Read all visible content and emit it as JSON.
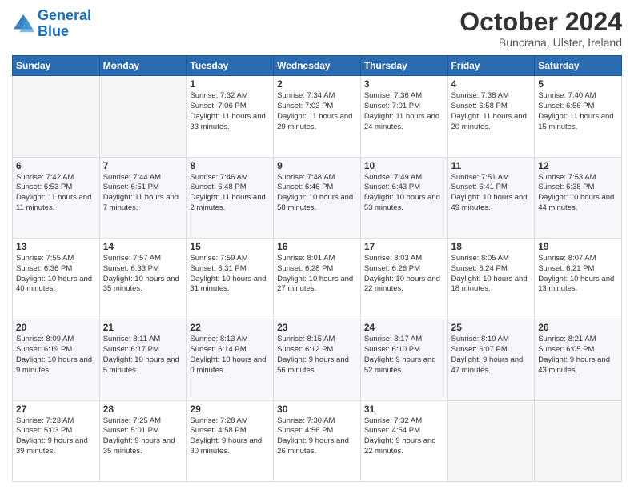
{
  "logo": {
    "text1": "General",
    "text2": "Blue"
  },
  "header": {
    "month": "October 2024",
    "location": "Buncrana, Ulster, Ireland"
  },
  "weekdays": [
    "Sunday",
    "Monday",
    "Tuesday",
    "Wednesday",
    "Thursday",
    "Friday",
    "Saturday"
  ],
  "weeks": [
    [
      {
        "day": "",
        "sunrise": "",
        "sunset": "",
        "daylight": ""
      },
      {
        "day": "",
        "sunrise": "",
        "sunset": "",
        "daylight": ""
      },
      {
        "day": "1",
        "sunrise": "Sunrise: 7:32 AM",
        "sunset": "Sunset: 7:06 PM",
        "daylight": "Daylight: 11 hours and 33 minutes."
      },
      {
        "day": "2",
        "sunrise": "Sunrise: 7:34 AM",
        "sunset": "Sunset: 7:03 PM",
        "daylight": "Daylight: 11 hours and 29 minutes."
      },
      {
        "day": "3",
        "sunrise": "Sunrise: 7:36 AM",
        "sunset": "Sunset: 7:01 PM",
        "daylight": "Daylight: 11 hours and 24 minutes."
      },
      {
        "day": "4",
        "sunrise": "Sunrise: 7:38 AM",
        "sunset": "Sunset: 6:58 PM",
        "daylight": "Daylight: 11 hours and 20 minutes."
      },
      {
        "day": "5",
        "sunrise": "Sunrise: 7:40 AM",
        "sunset": "Sunset: 6:56 PM",
        "daylight": "Daylight: 11 hours and 15 minutes."
      }
    ],
    [
      {
        "day": "6",
        "sunrise": "Sunrise: 7:42 AM",
        "sunset": "Sunset: 6:53 PM",
        "daylight": "Daylight: 11 hours and 11 minutes."
      },
      {
        "day": "7",
        "sunrise": "Sunrise: 7:44 AM",
        "sunset": "Sunset: 6:51 PM",
        "daylight": "Daylight: 11 hours and 7 minutes."
      },
      {
        "day": "8",
        "sunrise": "Sunrise: 7:46 AM",
        "sunset": "Sunset: 6:48 PM",
        "daylight": "Daylight: 11 hours and 2 minutes."
      },
      {
        "day": "9",
        "sunrise": "Sunrise: 7:48 AM",
        "sunset": "Sunset: 6:46 PM",
        "daylight": "Daylight: 10 hours and 58 minutes."
      },
      {
        "day": "10",
        "sunrise": "Sunrise: 7:49 AM",
        "sunset": "Sunset: 6:43 PM",
        "daylight": "Daylight: 10 hours and 53 minutes."
      },
      {
        "day": "11",
        "sunrise": "Sunrise: 7:51 AM",
        "sunset": "Sunset: 6:41 PM",
        "daylight": "Daylight: 10 hours and 49 minutes."
      },
      {
        "day": "12",
        "sunrise": "Sunrise: 7:53 AM",
        "sunset": "Sunset: 6:38 PM",
        "daylight": "Daylight: 10 hours and 44 minutes."
      }
    ],
    [
      {
        "day": "13",
        "sunrise": "Sunrise: 7:55 AM",
        "sunset": "Sunset: 6:36 PM",
        "daylight": "Daylight: 10 hours and 40 minutes."
      },
      {
        "day": "14",
        "sunrise": "Sunrise: 7:57 AM",
        "sunset": "Sunset: 6:33 PM",
        "daylight": "Daylight: 10 hours and 35 minutes."
      },
      {
        "day": "15",
        "sunrise": "Sunrise: 7:59 AM",
        "sunset": "Sunset: 6:31 PM",
        "daylight": "Daylight: 10 hours and 31 minutes."
      },
      {
        "day": "16",
        "sunrise": "Sunrise: 8:01 AM",
        "sunset": "Sunset: 6:28 PM",
        "daylight": "Daylight: 10 hours and 27 minutes."
      },
      {
        "day": "17",
        "sunrise": "Sunrise: 8:03 AM",
        "sunset": "Sunset: 6:26 PM",
        "daylight": "Daylight: 10 hours and 22 minutes."
      },
      {
        "day": "18",
        "sunrise": "Sunrise: 8:05 AM",
        "sunset": "Sunset: 6:24 PM",
        "daylight": "Daylight: 10 hours and 18 minutes."
      },
      {
        "day": "19",
        "sunrise": "Sunrise: 8:07 AM",
        "sunset": "Sunset: 6:21 PM",
        "daylight": "Daylight: 10 hours and 13 minutes."
      }
    ],
    [
      {
        "day": "20",
        "sunrise": "Sunrise: 8:09 AM",
        "sunset": "Sunset: 6:19 PM",
        "daylight": "Daylight: 10 hours and 9 minutes."
      },
      {
        "day": "21",
        "sunrise": "Sunrise: 8:11 AM",
        "sunset": "Sunset: 6:17 PM",
        "daylight": "Daylight: 10 hours and 5 minutes."
      },
      {
        "day": "22",
        "sunrise": "Sunrise: 8:13 AM",
        "sunset": "Sunset: 6:14 PM",
        "daylight": "Daylight: 10 hours and 0 minutes."
      },
      {
        "day": "23",
        "sunrise": "Sunrise: 8:15 AM",
        "sunset": "Sunset: 6:12 PM",
        "daylight": "Daylight: 9 hours and 56 minutes."
      },
      {
        "day": "24",
        "sunrise": "Sunrise: 8:17 AM",
        "sunset": "Sunset: 6:10 PM",
        "daylight": "Daylight: 9 hours and 52 minutes."
      },
      {
        "day": "25",
        "sunrise": "Sunrise: 8:19 AM",
        "sunset": "Sunset: 6:07 PM",
        "daylight": "Daylight: 9 hours and 47 minutes."
      },
      {
        "day": "26",
        "sunrise": "Sunrise: 8:21 AM",
        "sunset": "Sunset: 6:05 PM",
        "daylight": "Daylight: 9 hours and 43 minutes."
      }
    ],
    [
      {
        "day": "27",
        "sunrise": "Sunrise: 7:23 AM",
        "sunset": "Sunset: 5:03 PM",
        "daylight": "Daylight: 9 hours and 39 minutes."
      },
      {
        "day": "28",
        "sunrise": "Sunrise: 7:25 AM",
        "sunset": "Sunset: 5:01 PM",
        "daylight": "Daylight: 9 hours and 35 minutes."
      },
      {
        "day": "29",
        "sunrise": "Sunrise: 7:28 AM",
        "sunset": "Sunset: 4:58 PM",
        "daylight": "Daylight: 9 hours and 30 minutes."
      },
      {
        "day": "30",
        "sunrise": "Sunrise: 7:30 AM",
        "sunset": "Sunset: 4:56 PM",
        "daylight": "Daylight: 9 hours and 26 minutes."
      },
      {
        "day": "31",
        "sunrise": "Sunrise: 7:32 AM",
        "sunset": "Sunset: 4:54 PM",
        "daylight": "Daylight: 9 hours and 22 minutes."
      },
      {
        "day": "",
        "sunrise": "",
        "sunset": "",
        "daylight": ""
      },
      {
        "day": "",
        "sunrise": "",
        "sunset": "",
        "daylight": ""
      }
    ]
  ]
}
